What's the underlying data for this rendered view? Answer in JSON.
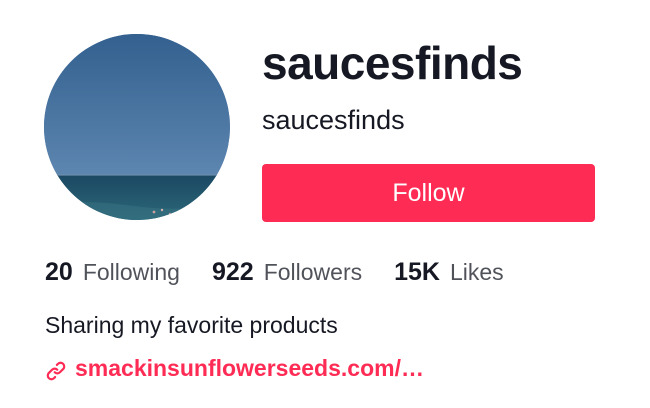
{
  "profile": {
    "username": "saucesfinds",
    "nickname": "saucesfinds",
    "follow_label": "Follow",
    "bio": "Sharing my favorite products",
    "link": "smackinsunflowerseeds.com/…"
  },
  "stats": [
    {
      "number": "20",
      "label": "Following"
    },
    {
      "number": "922",
      "label": "Followers"
    },
    {
      "number": "15K",
      "label": "Likes"
    }
  ],
  "icons": {
    "avatar": "profile-avatar-ocean-image",
    "link": "link-icon"
  },
  "colors": {
    "accent": "#fe2c55",
    "text": "#161823",
    "secondary_text": "#5c5d65"
  }
}
